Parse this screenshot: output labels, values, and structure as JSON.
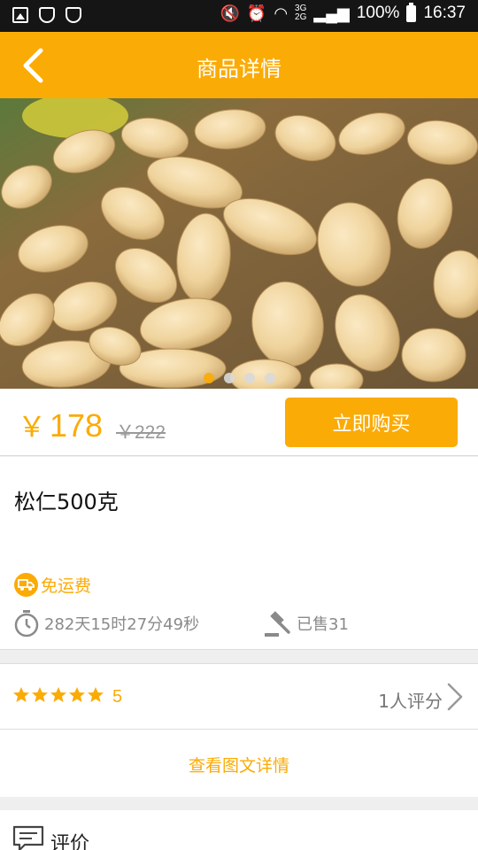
{
  "status_bar": {
    "battery": "100%",
    "time": "16:37",
    "network_top": "3G",
    "network_bottom": "2G"
  },
  "header": {
    "title": "商品详情",
    "back_icon": "chevron-left-icon"
  },
  "carousel": {
    "slide_count": 4,
    "active_index": 0
  },
  "price": {
    "currency": "￥",
    "current": "178",
    "original": "￥222",
    "buy_label": "立即购买"
  },
  "product": {
    "name": "松仁500克",
    "shipping": "免运费",
    "countdown": "282天15时27分49秒",
    "sold": "已售31"
  },
  "rating": {
    "stars": 5,
    "score": "5",
    "count_text": "1人评分"
  },
  "details": {
    "link_label": "查看图文详情"
  },
  "reviews": {
    "title": "评价"
  },
  "colors": {
    "accent": "#fbab05",
    "status_bar": "#151515",
    "muted": "#8a8a8a"
  }
}
